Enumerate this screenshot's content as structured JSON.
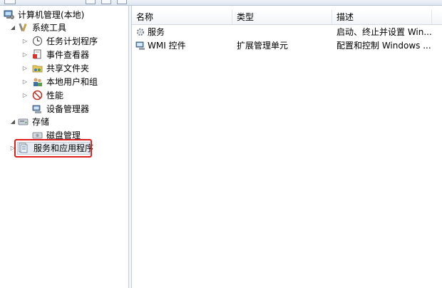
{
  "tree": {
    "root": "计算机管理(本地)",
    "system_tools": "系统工具",
    "task_scheduler": "任务计划程序",
    "event_viewer": "事件查看器",
    "shared_folders": "共享文件夹",
    "local_users": "本地用户和组",
    "performance": "性能",
    "device_manager": "设备管理器",
    "storage": "存储",
    "disk_management": "磁盘管理",
    "services_apps": "服务和应用程序"
  },
  "list": {
    "columns": [
      "名称",
      "类型",
      "描述"
    ],
    "rows": [
      {
        "name": "服务",
        "type": "",
        "desc": "启动、终止并设置 Win..."
      },
      {
        "name": "WMI 控件",
        "type": "扩展管理单元",
        "desc": "配置和控制 Windows ..."
      }
    ]
  },
  "colors": {
    "highlight": "#e01e1e",
    "selection": "#e8ecf2"
  },
  "icons": [
    "computer-management-icon",
    "tools-icon",
    "clock-icon",
    "event-viewer-icon",
    "shared-folder-icon",
    "users-icon",
    "performance-icon",
    "device-manager-icon",
    "storage-icon",
    "disk-icon",
    "services-apps-icon",
    "services-gear-icon",
    "wmi-icon"
  ]
}
